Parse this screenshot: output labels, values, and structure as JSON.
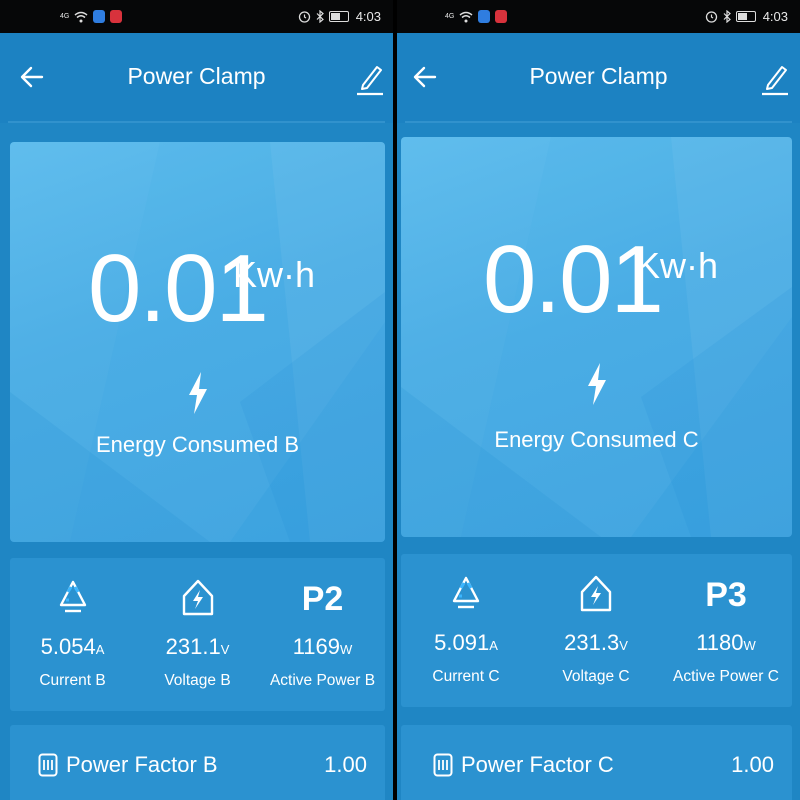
{
  "status_bar": {
    "time": "4:03",
    "network": "4G"
  },
  "screens": [
    {
      "title": "Power Clamp",
      "energy": {
        "value": "0.01",
        "unit": "Kw·h",
        "label": "Energy Consumed B"
      },
      "metrics": [
        {
          "icon": "recycle-icon",
          "value": "5.054",
          "unit": "A",
          "label": "Current B"
        },
        {
          "icon": "house-bolt-icon",
          "value": "231.1",
          "unit": "V",
          "label": "Voltage B"
        },
        {
          "code": "P2",
          "value": "1169",
          "unit": "W",
          "label": "Active Power B"
        }
      ],
      "power_factor": {
        "label": "Power Factor B",
        "value": "1.00"
      }
    },
    {
      "title": "Power Clamp",
      "energy": {
        "value": "0.01",
        "unit": "Kw·h",
        "label": "Energy Consumed C"
      },
      "metrics": [
        {
          "icon": "recycle-icon",
          "value": "5.091",
          "unit": "A",
          "label": "Current C"
        },
        {
          "icon": "house-bolt-icon",
          "value": "231.3",
          "unit": "V",
          "label": "Voltage C"
        },
        {
          "code": "P3",
          "value": "1180",
          "unit": "W",
          "label": "Active Power C"
        }
      ],
      "power_factor": {
        "label": "Power Factor C",
        "value": "1.00"
      }
    }
  ],
  "colors": {
    "app_bar": "#1c82c2",
    "background": "#1f86c4",
    "card": "#2b92d0",
    "energy_card": "#45ace5",
    "status_bar": "#060708",
    "text": "#ffffff"
  }
}
